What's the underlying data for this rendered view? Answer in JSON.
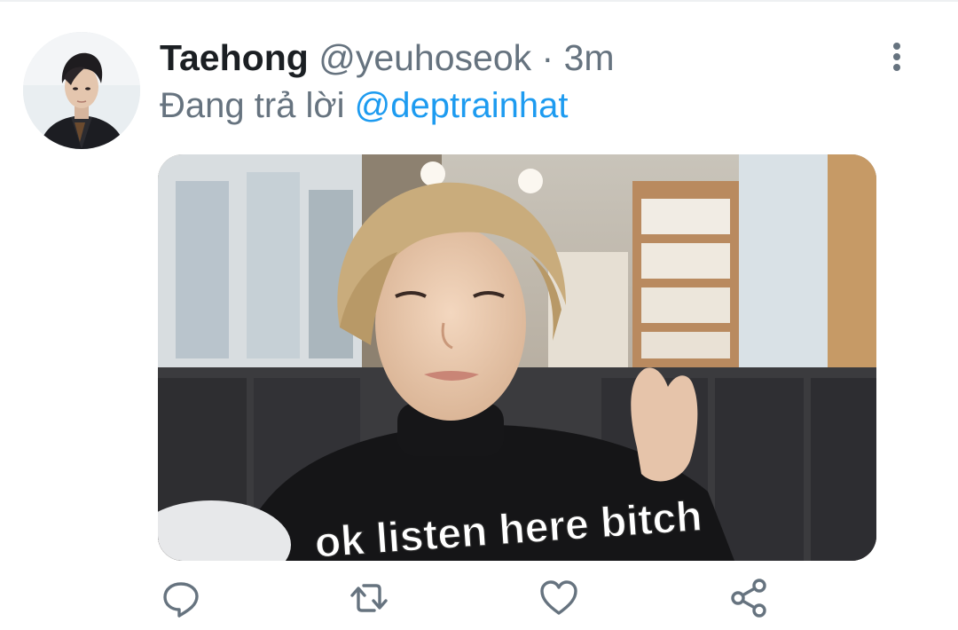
{
  "tweet": {
    "author_name": "Taehong",
    "handle": "@yeuhoseok",
    "separator": "·",
    "time": "3m",
    "reply_prefix": "Đang trả lời",
    "reply_mention": "@deptrainhat",
    "media": {
      "caption_text": "ok listen here bitch"
    }
  },
  "actions": {
    "reply_icon": "reply-icon",
    "retweet_icon": "retweet-icon",
    "like_icon": "heart-icon",
    "share_icon": "share-icon"
  },
  "colors": {
    "text_primary": "#1b1f23",
    "text_secondary": "#66737f",
    "link": "#1d9bf0"
  }
}
